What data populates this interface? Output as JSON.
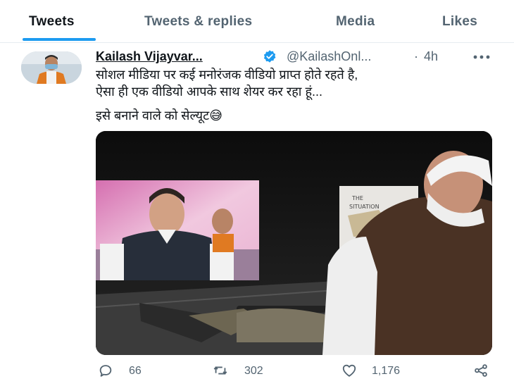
{
  "tabs": [
    {
      "label": "Tweets",
      "active": true
    },
    {
      "label": "Tweets & replies",
      "active": false
    },
    {
      "label": "Media",
      "active": false
    },
    {
      "label": "Likes",
      "active": false
    }
  ],
  "tweet": {
    "author_name": "Kailash Vijayvar...",
    "handle": "@KailashOnl...",
    "separator": "·",
    "time": "4h",
    "verified": true,
    "text_line1": "सोशल मीडिया पर कई मनोरंजक वीडियो प्राप्त होते रहते है,",
    "text_line2": "ऐसा ही एक वीडियो आपके साथ शेयर कर रहा हूं...",
    "text_line3": "इसे बनाने वाले को सेल्यूट😅",
    "media": {
      "screen_sign_line1": "THE",
      "screen_sign_line2": "SITUATION"
    }
  },
  "actions": {
    "replies": "66",
    "retweets": "302",
    "likes": "1,176"
  },
  "colors": {
    "accent": "#1d9bf0",
    "secondary_text": "#536471",
    "primary_text": "#0f1419"
  },
  "icons": [
    "verified-badge-icon",
    "more-options-icon",
    "reply-icon",
    "retweet-icon",
    "like-icon",
    "share-icon"
  ]
}
